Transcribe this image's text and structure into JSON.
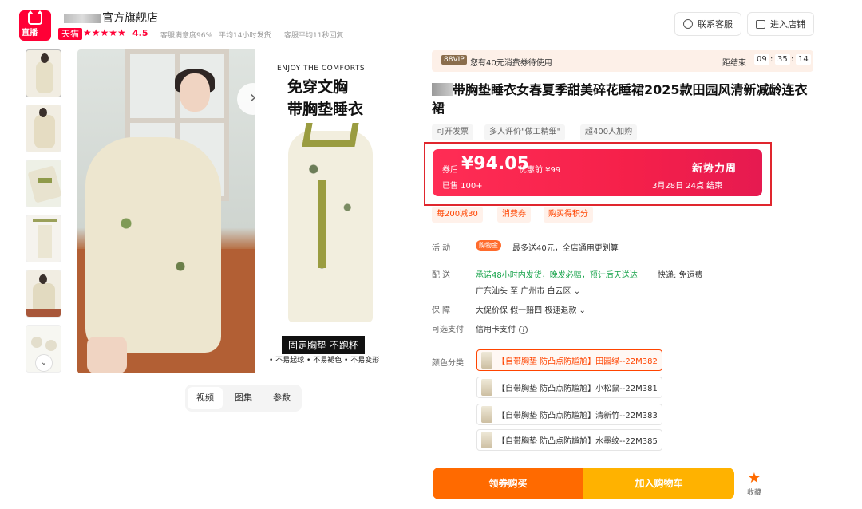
{
  "header": {
    "logo_label": "直播",
    "shop_name": "官方旗舰店",
    "tmall_badge": "天猫",
    "stars": "★★★★★",
    "rating": "4.5",
    "metrics": [
      "客服满意度96%",
      "平均14小时发货",
      "客服平均11秒回复"
    ],
    "customer_service": "联系客服",
    "enter_shop": "进入店铺"
  },
  "media": {
    "ad_en": "ENJOY THE COMFORTS",
    "ad_cn_line1": "免穿文胸",
    "ad_cn_line2": "带胸垫睡衣",
    "ad_tag": "固定胸垫  不跑杯",
    "ad_sub": "• 不易起球 • 不易褪色 • 不易变形",
    "pager_arrow": "›",
    "scroll_down": "⌄",
    "tabs": [
      "视频",
      "图集",
      "参数"
    ]
  },
  "promo_bar": {
    "vip_tag": "88VIP",
    "text": "您有40元消费券待使用",
    "end_label": "距结束",
    "h": "09",
    "m": "35",
    "s": "14"
  },
  "product": {
    "title": "带胸垫睡衣女春夏季甜美碎花睡裙2025款田园风清新减龄连衣裙",
    "tags": [
      "可开发票",
      "多人评价\"做工精细\"",
      "超400人加购"
    ]
  },
  "price": {
    "label": "券后",
    "value": "¥94.05",
    "original": "优惠前 ¥99",
    "sold": "已售 100+",
    "promo_title": "新势力周",
    "promo_date": "3月28日 24点 结束"
  },
  "coupons": [
    "每200减30",
    "消费券",
    "购买得积分"
  ],
  "details": {
    "activity_label": "活      动",
    "activity_badge": "购物金",
    "activity_text": "最多送40元，全店通用更划算",
    "delivery_label": "配      送",
    "delivery_promise": "承诺48小时内发货，晚发必赔，预计后天送达",
    "delivery_fee": "快递: 免运费",
    "delivery_route": "广东汕头  至  广州市 白云区 ⌄",
    "guarantee_label": "保      障",
    "guarantee_text": "大促价保 假一赔四 极速退款 ⌄",
    "payment_label": "可选支付",
    "payment_text": "信用卡支付",
    "payment_info": "i",
    "color_label": "颜色分类"
  },
  "variants": [
    "【自带胸垫 防凸点防尴尬】田园绿--22M382",
    "【自带胸垫 防凸点防尴尬】小松鼠--22M381",
    "【自带胸垫 防凸点防尴尬】清新竹--22M383",
    "【自带胸垫 防凸点防尴尬】水墨纹--22M385"
  ],
  "actions": {
    "buy_now": "领券购买",
    "add_cart": "加入购物车",
    "favorite_icon": "★",
    "favorite": "收藏"
  },
  "colors": {
    "brand_red": "#ff0036",
    "price_card": "#f5204a",
    "buy_now": "#ff6a00",
    "add_cart": "#ffb200"
  }
}
